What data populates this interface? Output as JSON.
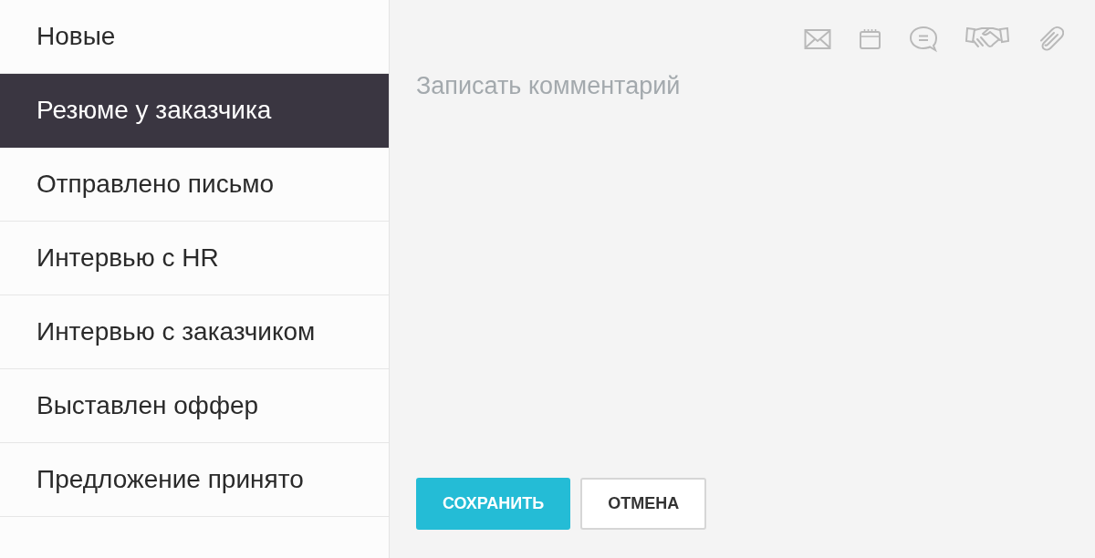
{
  "sidebar": {
    "items": [
      {
        "label": "Новые",
        "selected": false
      },
      {
        "label": "Резюме у заказчика",
        "selected": true
      },
      {
        "label": "Отправлено письмо",
        "selected": false
      },
      {
        "label": "Интервью с HR",
        "selected": false
      },
      {
        "label": "Интервью с заказчиком",
        "selected": false
      },
      {
        "label": "Выставлен оффер",
        "selected": false
      },
      {
        "label": "Предложение принято",
        "selected": false
      }
    ]
  },
  "toolbar": {
    "icons": [
      {
        "kind": "mail"
      },
      {
        "kind": "calendar"
      },
      {
        "kind": "comment"
      },
      {
        "kind": "handshake"
      },
      {
        "kind": "attach"
      }
    ]
  },
  "comment": {
    "placeholder": "Записать комментарий"
  },
  "buttons": [
    {
      "kind": "primary",
      "label": "СОХРАНИТЬ"
    },
    {
      "kind": "secondary",
      "label": "ОТМЕНА"
    }
  ]
}
